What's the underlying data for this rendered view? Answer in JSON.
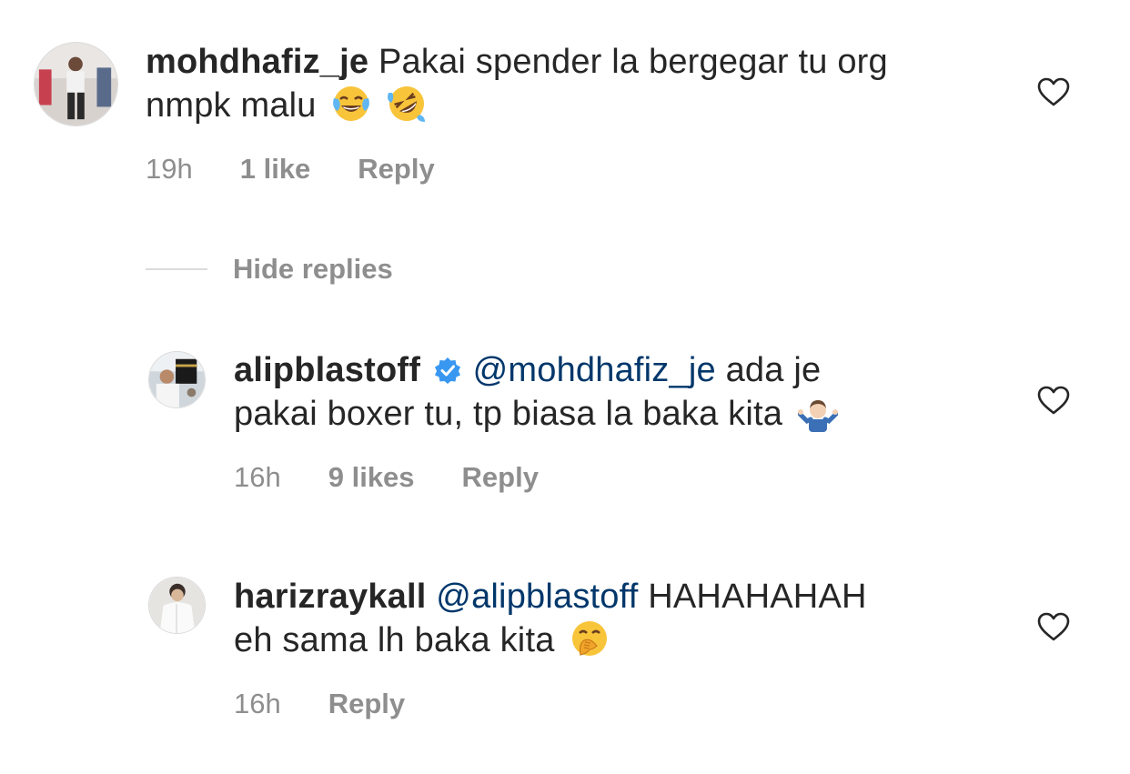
{
  "comments": [
    {
      "username": "mohdhafiz_je",
      "text_line1": "Pakai spender la bergegar tu org",
      "text_line2": "nmpk malu",
      "emojis": [
        "face-with-tears-of-joy",
        "rolling-on-the-floor-laughing"
      ],
      "time": "19h",
      "likes": "1 like",
      "reply": "Reply"
    }
  ],
  "hide_replies": "Hide replies",
  "replies": [
    {
      "username": "alipblastoff",
      "verified": true,
      "mention": "@mohdhafiz_je",
      "text_line1": "ada je",
      "text_line2": "pakai boxer tu, tp biasa la baka kita",
      "emoji": "person-shrugging",
      "time": "16h",
      "likes": "9 likes",
      "reply": "Reply"
    },
    {
      "username": "harizraykall",
      "mention": "@alipblastoff",
      "text_line1": "HAHAHAHAH",
      "text_line2": "eh sama lh baka kita",
      "emoji": "face-with-hand-over-mouth",
      "time": "16h",
      "reply": "Reply"
    }
  ],
  "colors": {
    "text": "#262626",
    "secondary": "#8e8e8e",
    "mention": "#00376b",
    "verified": "#3897f0"
  }
}
